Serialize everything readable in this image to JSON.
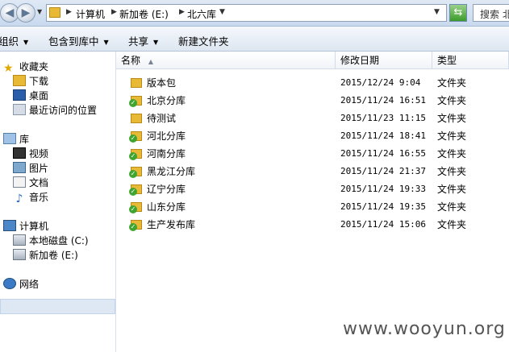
{
  "address": {
    "crumbs": [
      "计算机",
      "新加卷 (E:)",
      "北六库"
    ],
    "search_placeholder": "搜索 北"
  },
  "toolbar": {
    "organize": "组织",
    "include_in_library": "包含到库中",
    "share": "共享",
    "new_folder": "新建文件夹"
  },
  "nav": {
    "favorites": "收藏夹",
    "downloads": "下载",
    "desktop": "桌面",
    "recent": "最近访问的位置",
    "libraries": "库",
    "videos": "视频",
    "pictures": "图片",
    "documents": "文档",
    "music": "音乐",
    "computer": "计算机",
    "local_disk": "本地磁盘 (C:)",
    "new_volume": "新加卷 (E:)",
    "network": "网络"
  },
  "columns": {
    "name": "名称",
    "modified": "修改日期",
    "type": "类型"
  },
  "files": [
    {
      "name": "版本包",
      "date": "2015/12/24 9:04",
      "type": "文件夹",
      "synced": false
    },
    {
      "name": "北京分库",
      "date": "2015/11/24 16:51",
      "type": "文件夹",
      "synced": true
    },
    {
      "name": "待测试",
      "date": "2015/11/23 11:15",
      "type": "文件夹",
      "synced": false
    },
    {
      "name": "河北分库",
      "date": "2015/11/24 18:41",
      "type": "文件夹",
      "synced": true
    },
    {
      "name": "河南分库",
      "date": "2015/11/24 16:55",
      "type": "文件夹",
      "synced": true
    },
    {
      "name": "黑龙江分库",
      "date": "2015/11/24 21:37",
      "type": "文件夹",
      "synced": true
    },
    {
      "name": "辽宁分库",
      "date": "2015/11/24 19:33",
      "type": "文件夹",
      "synced": true
    },
    {
      "name": "山东分库",
      "date": "2015/11/24 19:35",
      "type": "文件夹",
      "synced": true
    },
    {
      "name": "生产发布库",
      "date": "2015/11/24 15:06",
      "type": "文件夹",
      "synced": true
    }
  ],
  "watermark": "www.wooyun.org",
  "colors": {
    "folder": "#e8b934",
    "sync_badge": "#3fa52f",
    "selection": "#dde8f4"
  }
}
